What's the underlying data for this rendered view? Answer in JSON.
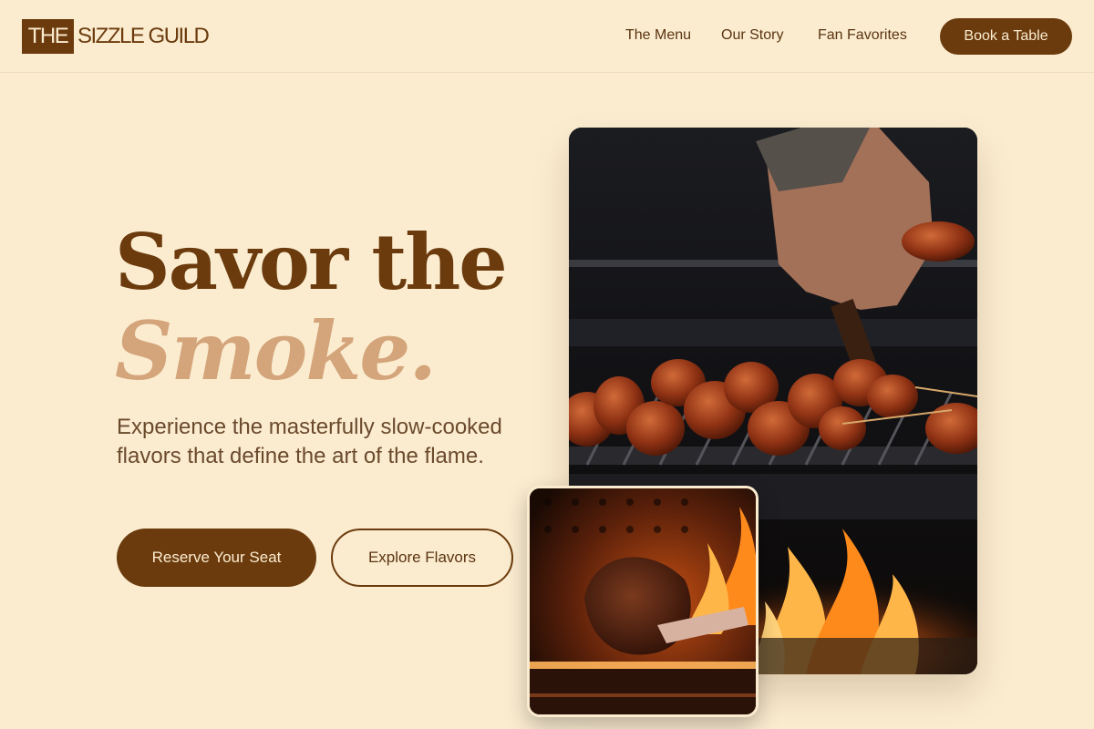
{
  "header": {
    "logo_box_text": "THE",
    "logo_text": "SIZZLE GUILD",
    "nav": [
      {
        "label": "The Menu"
      },
      {
        "label": "Our Story"
      },
      {
        "label": "Fan Favorites"
      }
    ],
    "cta_label": "Book a Table"
  },
  "hero": {
    "title_line1": "Savor the",
    "title_line2": "Smoke.",
    "description": "Experience the masterfully slow-cooked flavors that define the art of the flame.",
    "primary_button": "Reserve Your Seat",
    "secondary_button": "Explore Flavors"
  },
  "images": {
    "main": {
      "icon": "grilled-meat-skewers-photo"
    },
    "secondary": {
      "icon": "flame-grilled-steak-photo"
    }
  },
  "colors": {
    "background": "#fbecd0",
    "brand_brown": "#6b3b0d",
    "accent_tan": "#d4a47a",
    "text_body": "#6b4a2c"
  }
}
